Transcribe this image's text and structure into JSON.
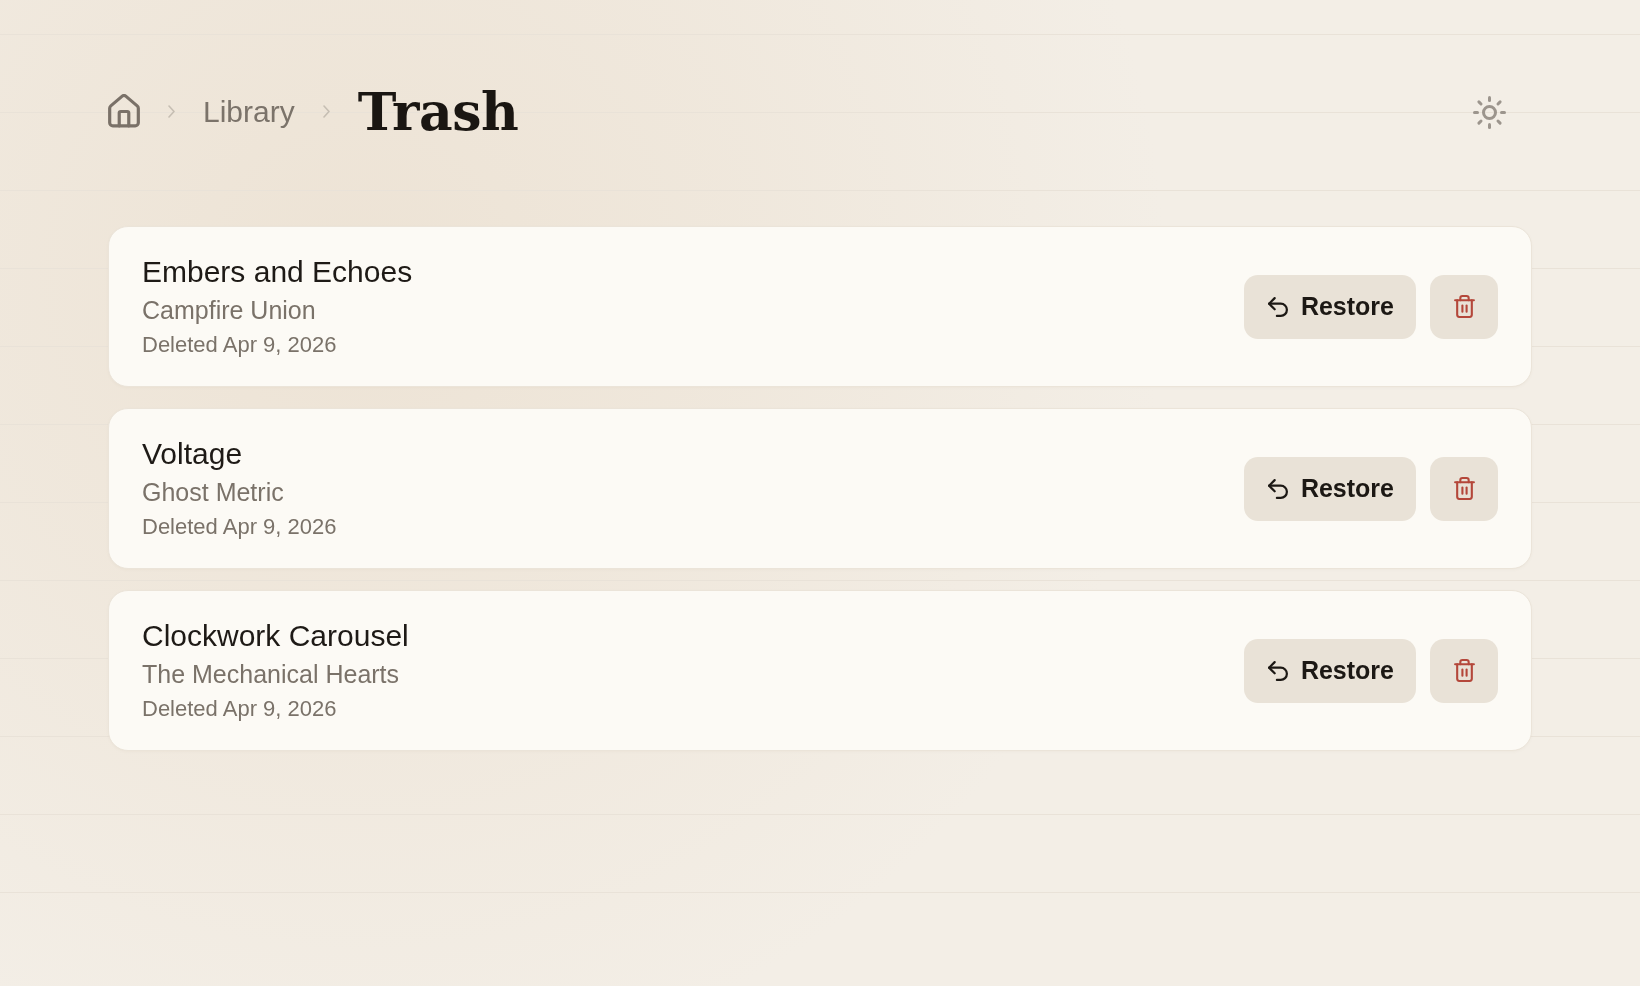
{
  "breadcrumb": {
    "links": [
      "Library"
    ],
    "current": "Trash"
  },
  "trash_items": [
    {
      "title": "Embers and Echoes",
      "artist": "Campfire Union",
      "deleted": "Deleted Apr 9, 2026",
      "restore_label": "Restore"
    },
    {
      "title": "Voltage",
      "artist": "Ghost Metric",
      "deleted": "Deleted Apr 9, 2026",
      "restore_label": "Restore"
    },
    {
      "title": "Clockwork Carousel",
      "artist": "The Mechanical Hearts",
      "deleted": "Deleted Apr 9, 2026",
      "restore_label": "Restore"
    }
  ]
}
